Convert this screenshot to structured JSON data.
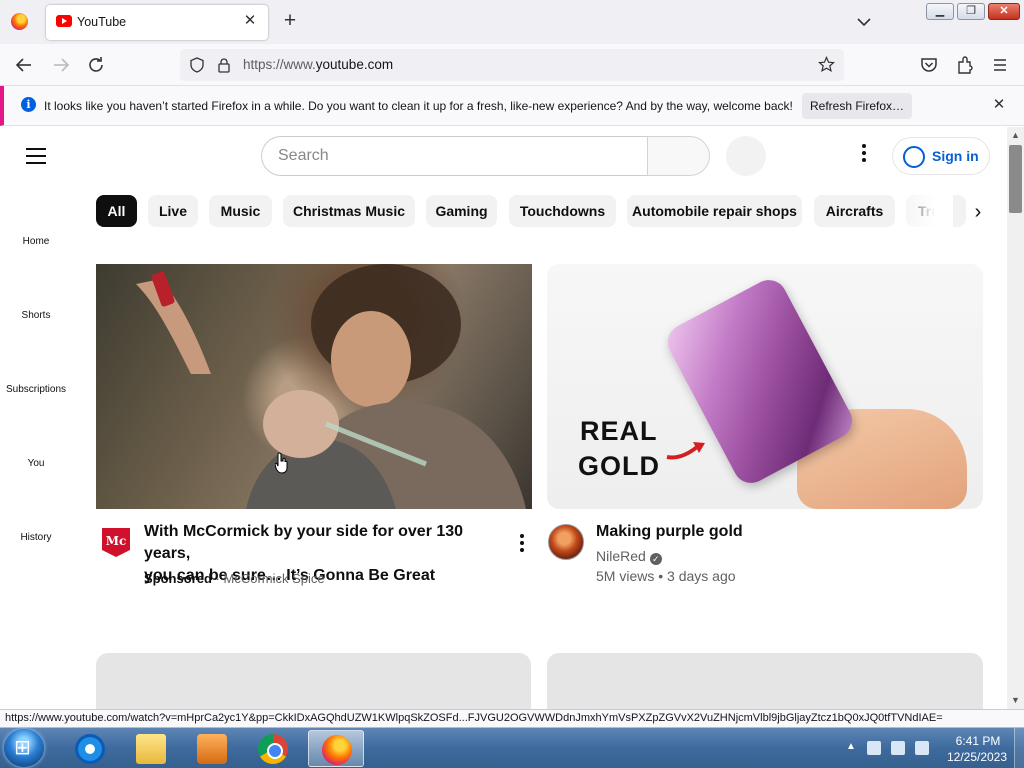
{
  "browser": {
    "tab_title": "YouTube",
    "url_prefix": "https://www.",
    "url_domain": "youtube.com",
    "notification": {
      "icon": "info-icon",
      "message": "It looks like you haven’t started Firefox in a while. Do you want to clean it up for a fresh, like-new experience? And by the way, welcome back!",
      "button_label": "Refresh Firefox…"
    },
    "status_url": "https://www.youtube.com/watch?v=mHprCa2yc1Y&pp=CkkIDxAGQhdUZW1KWlpqSkZOSFd...FJVGU2OGVWWDdnJmxhYmVsPXZpZGVvX2VuZHNjcmVlbl9jbGljayZtcz1bQ0xJQ0tfTVNdIAE=",
    "accent_color": "#e31587"
  },
  "youtube": {
    "search_placeholder": "Search",
    "sign_in_label": "Sign in",
    "chips": [
      "All",
      "Live",
      "Music",
      "Christmas Music",
      "Gaming",
      "Touchdowns",
      "Automobile repair shops",
      "Aircrafts",
      "Tru"
    ],
    "guide": [
      "Home",
      "Shorts",
      "Subscriptions",
      "You",
      "History"
    ],
    "videos": [
      {
        "title_line1": "With McCormick by your side for over 130 years,",
        "title_line2": "you can be sure… It’s Gonna Be Great",
        "sponsored": "Sponsored",
        "separator": "·",
        "channel": "McCormick Spice",
        "logo_text": "Mc"
      },
      {
        "title": "Making purple gold",
        "channel": "NileRed",
        "meta": "5M views • 3 days ago",
        "thumb_text_line1": "REAL",
        "thumb_text_line2": "GOLD"
      }
    ]
  },
  "taskbar": {
    "time": "6:41 PM",
    "date": "12/25/2023"
  }
}
